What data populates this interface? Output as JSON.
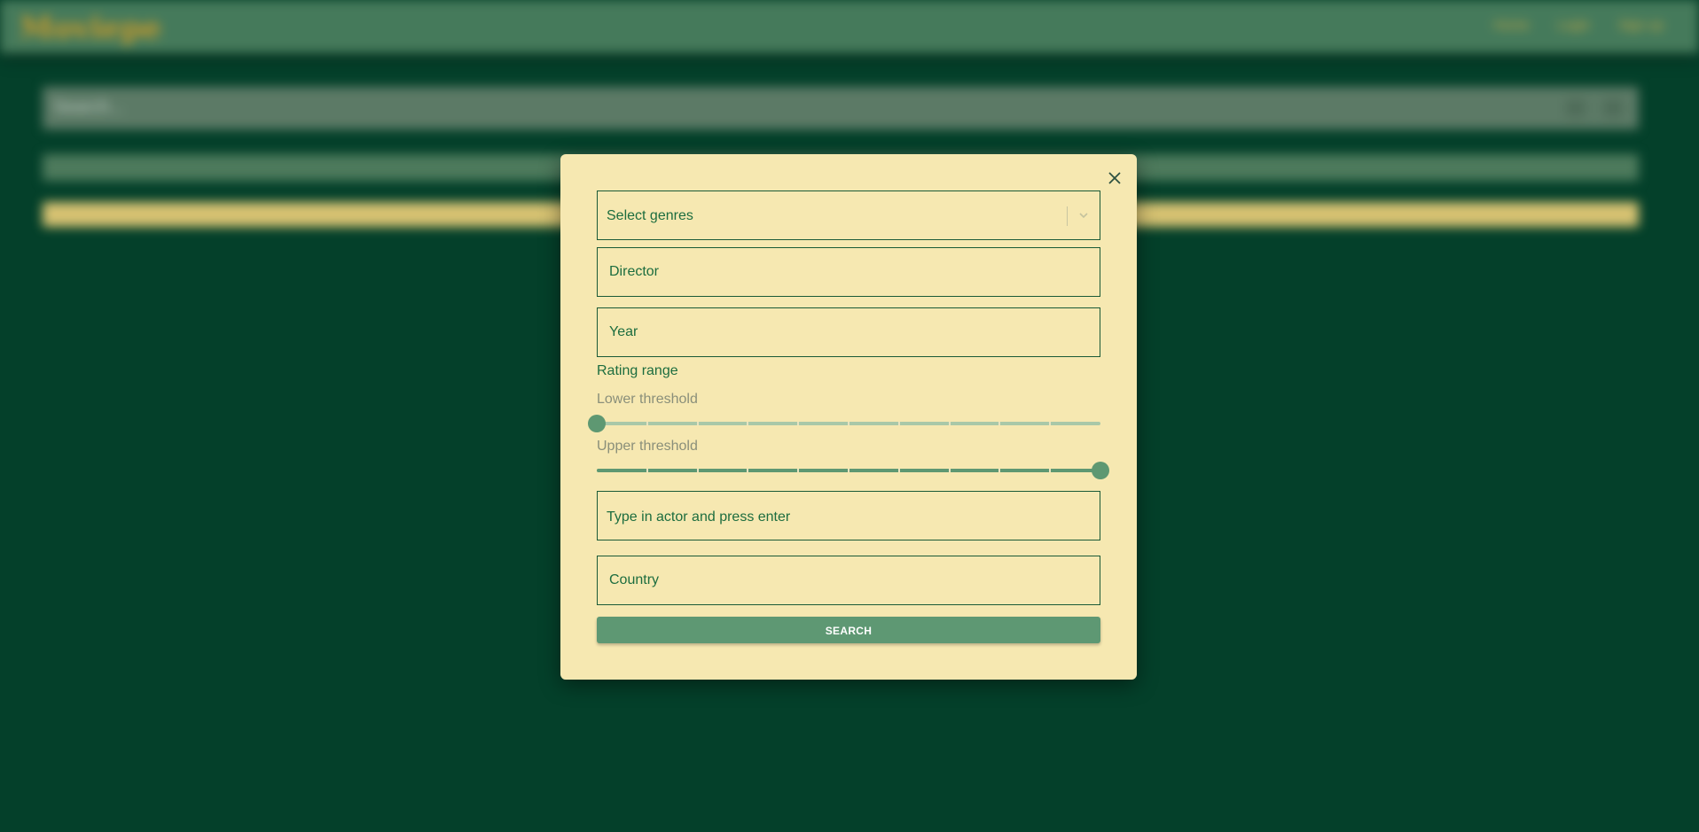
{
  "background": {
    "navbar": {
      "logo_text": "Moviepe",
      "links": [
        "Home",
        "Login",
        "Sign up"
      ]
    },
    "search_bar_text": "Search..."
  },
  "modal": {
    "genres_placeholder": "Select genres",
    "director_placeholder": "Director",
    "year_placeholder": "Year",
    "rating_range_label": "Rating range",
    "lower_threshold": {
      "label": "Lower threshold",
      "value_fraction": 0.0,
      "tick_count": 10
    },
    "upper_threshold": {
      "label": "Upper threshold",
      "value_fraction": 1.0,
      "tick_count": 10
    },
    "actor_placeholder": "Type in actor and press enter",
    "country_placeholder": "Country",
    "search_button_label": "SEARCH"
  },
  "colors": {
    "accent": "#5e9872",
    "modal_background": "#f6e8b1",
    "page_background": "#04402a"
  },
  "icons": {
    "close": "close-icon",
    "dropdown": "chevron-down-icon"
  }
}
